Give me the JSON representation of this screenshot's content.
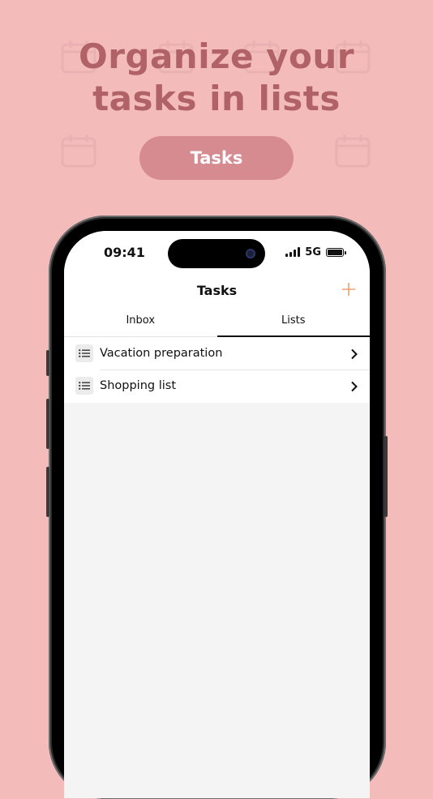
{
  "headline": {
    "line1": "Organize your",
    "line2": "tasks in lists"
  },
  "badge_button": {
    "label": "Tasks"
  },
  "status_bar": {
    "time": "09:41",
    "network": "5G"
  },
  "nav": {
    "title": "Tasks",
    "add_icon": "plus-icon"
  },
  "tabs": [
    {
      "label": "Inbox",
      "active": false
    },
    {
      "label": "Lists",
      "active": true
    }
  ],
  "lists": [
    {
      "label": "Vacation preparation",
      "icon": "list-icon",
      "chevron": "chevron-right-icon"
    },
    {
      "label": "Shopping list",
      "icon": "list-icon",
      "chevron": "chevron-right-icon"
    }
  ],
  "colors": {
    "background": "#f4bbbb",
    "headline": "#b06266",
    "pill": "#d68b90",
    "accent": "#f0a070"
  }
}
